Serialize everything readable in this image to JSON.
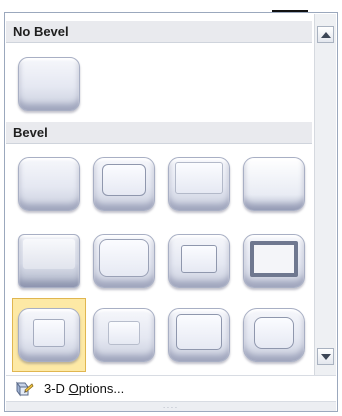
{
  "gallery": {
    "sections": [
      {
        "header": "No Bevel"
      },
      {
        "header": "Bevel"
      }
    ],
    "options_label": "3-D Options...",
    "options_mnemonic_index": 4,
    "grip_text": "....",
    "icons": {
      "scroll_up": "triangle-up-icon",
      "scroll_down": "triangle-down-icon",
      "options": "3d-options-icon"
    },
    "presets": [
      "Circle",
      "Relaxed Inset",
      "Cross",
      "Cool Slant",
      "Angle",
      "Soft Round",
      "Convex",
      "Slope",
      "Divot",
      "Riblet",
      "Hard Edge",
      "Art Deco"
    ],
    "selected_preset": "Divot"
  }
}
